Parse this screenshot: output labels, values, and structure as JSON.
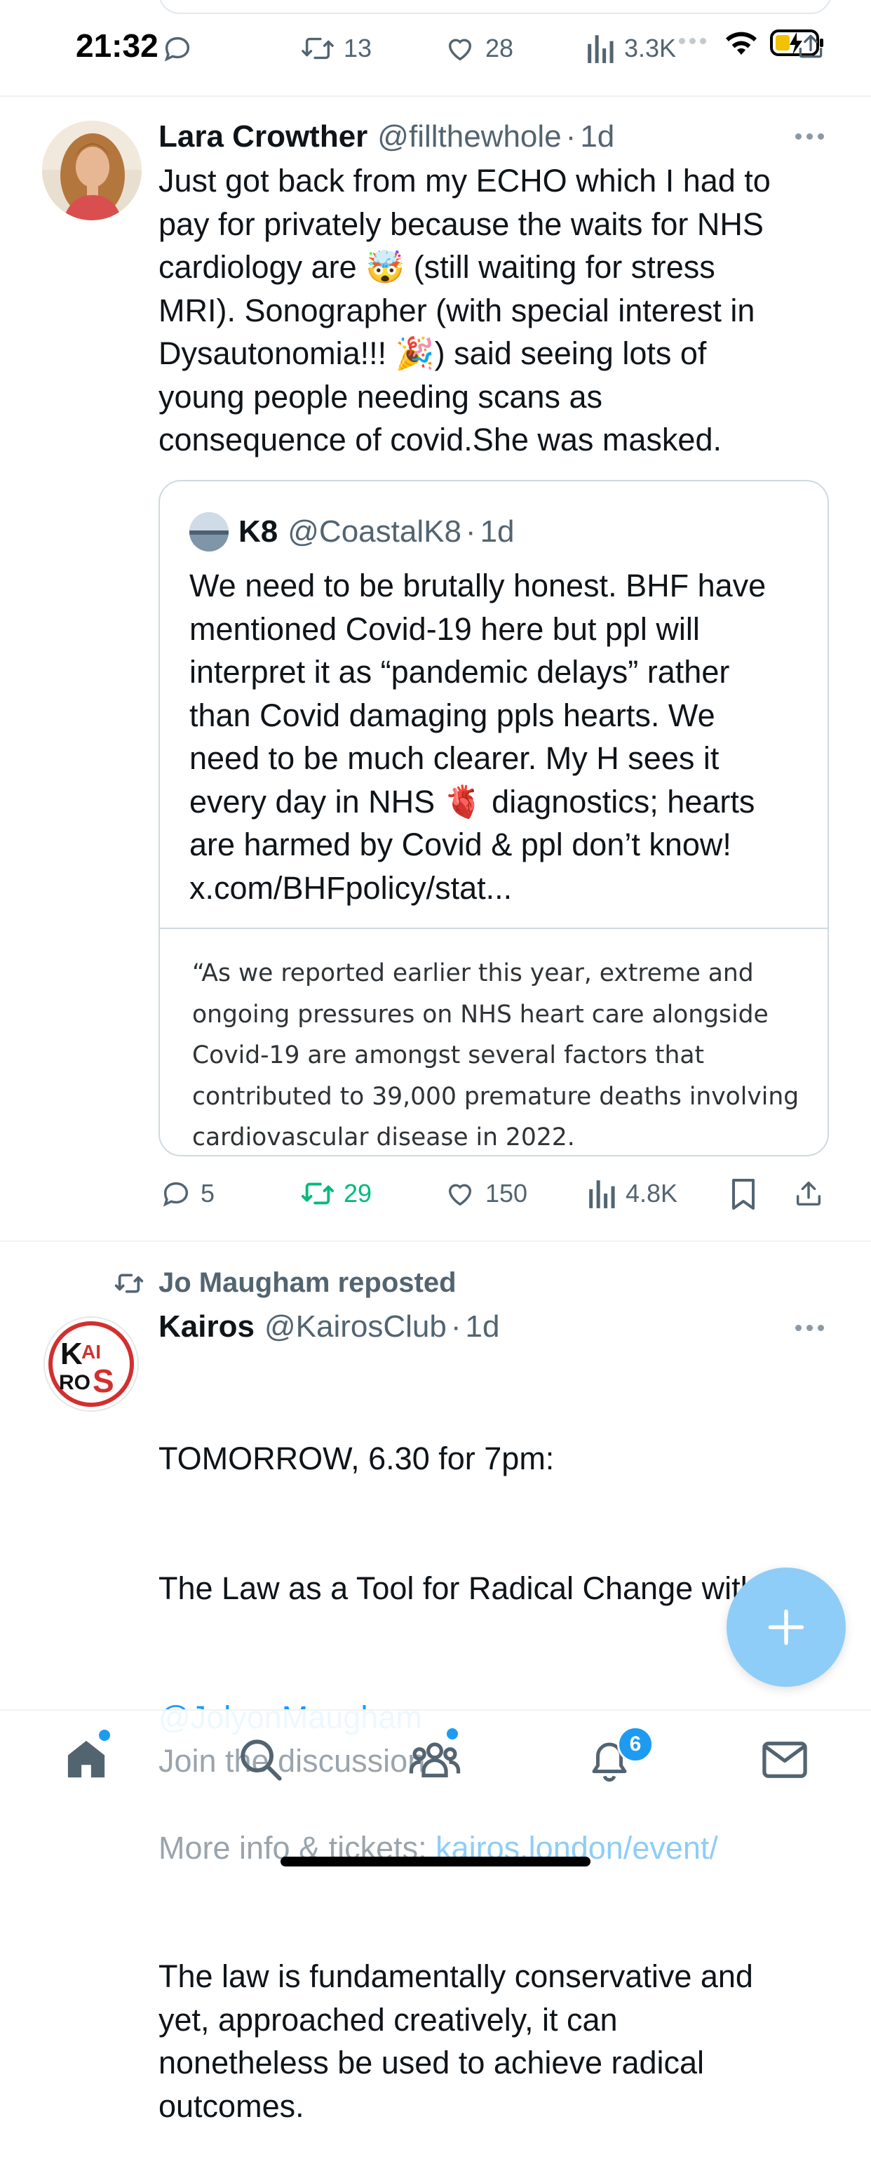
{
  "status_bar": {
    "time": "21:32"
  },
  "prev_tweet_actions": {
    "retweets": "13",
    "likes": "28",
    "views": "3.3K"
  },
  "tweet1": {
    "name": "Lara Crowther",
    "handle": "@fillthewhole",
    "dot": "·",
    "age": "1d",
    "text": "Just got back from my ECHO which I had to\npay for privately because the waits for NHS\ncardiology are 🤯 (still waiting for stress\nMRI). Sonographer (with special interest in\nDysautonomia!!! 🎉) said seeing lots of\nyoung people needing scans as\nconsequence of covid.She was masked.",
    "quote": {
      "name": "K8",
      "handle": "@CoastalK8",
      "dot": "·",
      "age": "1d",
      "text": "We need to be brutally honest. BHF have\nmentioned Covid-19 here but ppl will\ninterpret it as “pandemic delays” rather\nthan Covid damaging ppls hearts. We\nneed to be much clearer. My H sees it\nevery day in NHS 🫀 diagnostics; hearts\nare harmed by Covid & ppl don’t know!\nx.com/BHFpolicy/stat...",
      "excerpt": "“As we reported earlier this year, extreme and\nongoing pressures on NHS heart care alongside\nCovid-19 are amongst several factors that\ncontributed to 39,000 premature deaths involving\ncardiovascular disease in 2022."
    },
    "actions": {
      "replies": "5",
      "retweets": "29",
      "likes": "150",
      "views": "4.8K"
    }
  },
  "tweet2": {
    "reposted_by": "Jo Maugham reposted",
    "name": "Kairos",
    "handle": "@KairosClub",
    "dot": "·",
    "age": "1d",
    "line1": "TOMORROW, 6.30 for 7pm:",
    "line2": "The Law as a Tool for Radical Change with",
    "mention": "@JolyonMaugham",
    "para2": "The law is fundamentally conservative and\nyet, approached creatively, it can\nnonetheless be used to achieve radical\noutcomes.",
    "more_info_prefix": "More info & tickets: ",
    "more_info_link": "kairos.london/event/"
  },
  "reply_bar": {
    "placeholder": "Join the discussion"
  },
  "tab_bar": {
    "notifications_count": "6"
  },
  "colors": {
    "accent": "#1d9bf0",
    "retweet_active": "#00ba7c",
    "fab": "#8ecdf7",
    "muted": "#536471"
  }
}
